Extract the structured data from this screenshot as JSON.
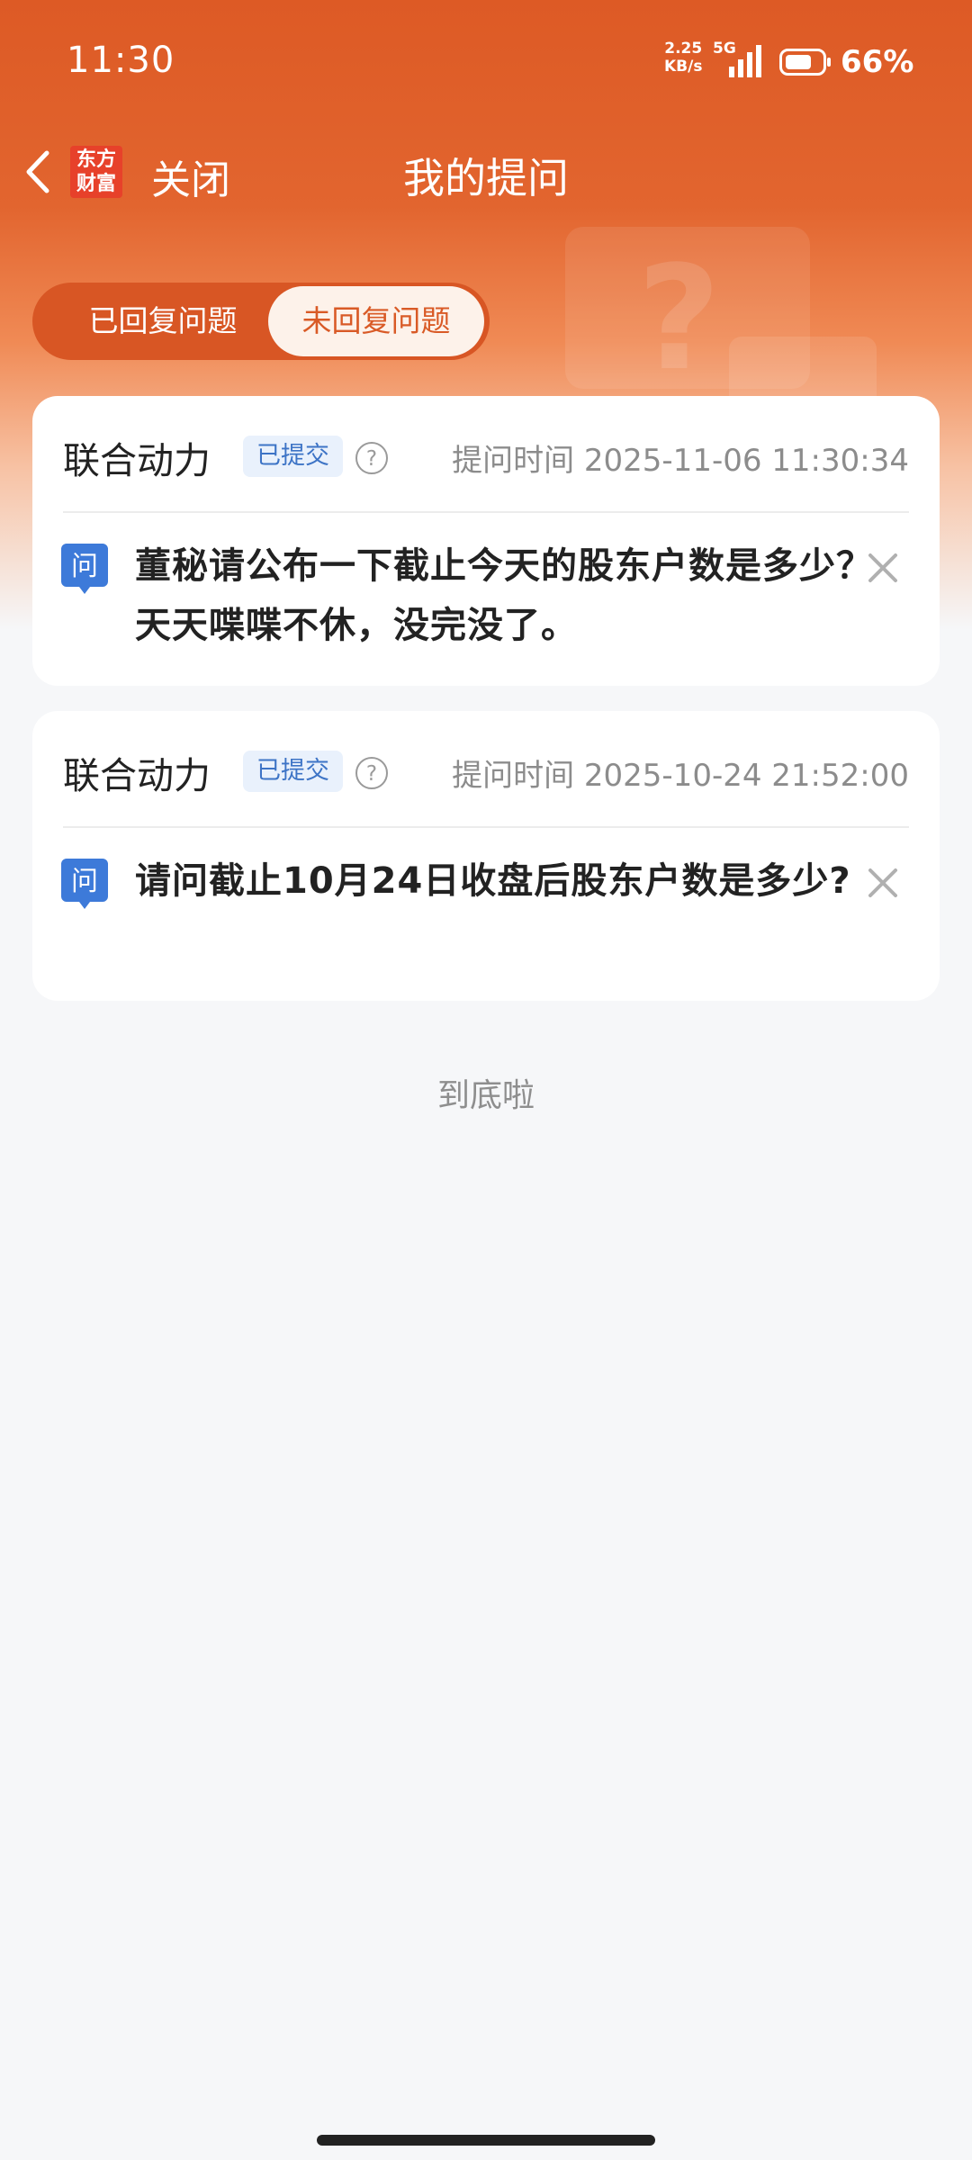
{
  "status_bar": {
    "time": "11:30",
    "net_speed_value": "2.25",
    "net_speed_unit": "KB/s",
    "net_type": "5G",
    "battery": "66%"
  },
  "nav": {
    "logo_line1": "东方",
    "logo_line2": "财富",
    "close_label": "关闭",
    "title": "我的提问"
  },
  "tabs": [
    {
      "label": "已回复问题",
      "active": false
    },
    {
      "label": "未回复问题",
      "active": true
    }
  ],
  "questions": [
    {
      "company": "联合动力",
      "status": "已提交",
      "time": "提问时间 2025-11-06 11:30:34",
      "badge_icon": "问",
      "text": "董秘请公布一下截止今天的股东户数是多少？天天喋喋不休，没完没了。"
    },
    {
      "company": "联合动力",
      "status": "已提交",
      "time": "提问时间 2025-10-24 21:52:00",
      "badge_icon": "问",
      "text": "请问截止10月24日收盘后股东户数是多少?"
    }
  ],
  "footer": {
    "end_text": "到底啦"
  },
  "colors": {
    "brand": "#dd5a25",
    "badge_bg": "#e9f1fc",
    "badge_text": "#3d74c6",
    "question_icon": "#3d7ad9"
  },
  "icons": [
    "back-arrow-icon",
    "app-logo",
    "help-icon",
    "question-badge-icon",
    "delete-icon",
    "signal-icon",
    "battery-icon"
  ]
}
